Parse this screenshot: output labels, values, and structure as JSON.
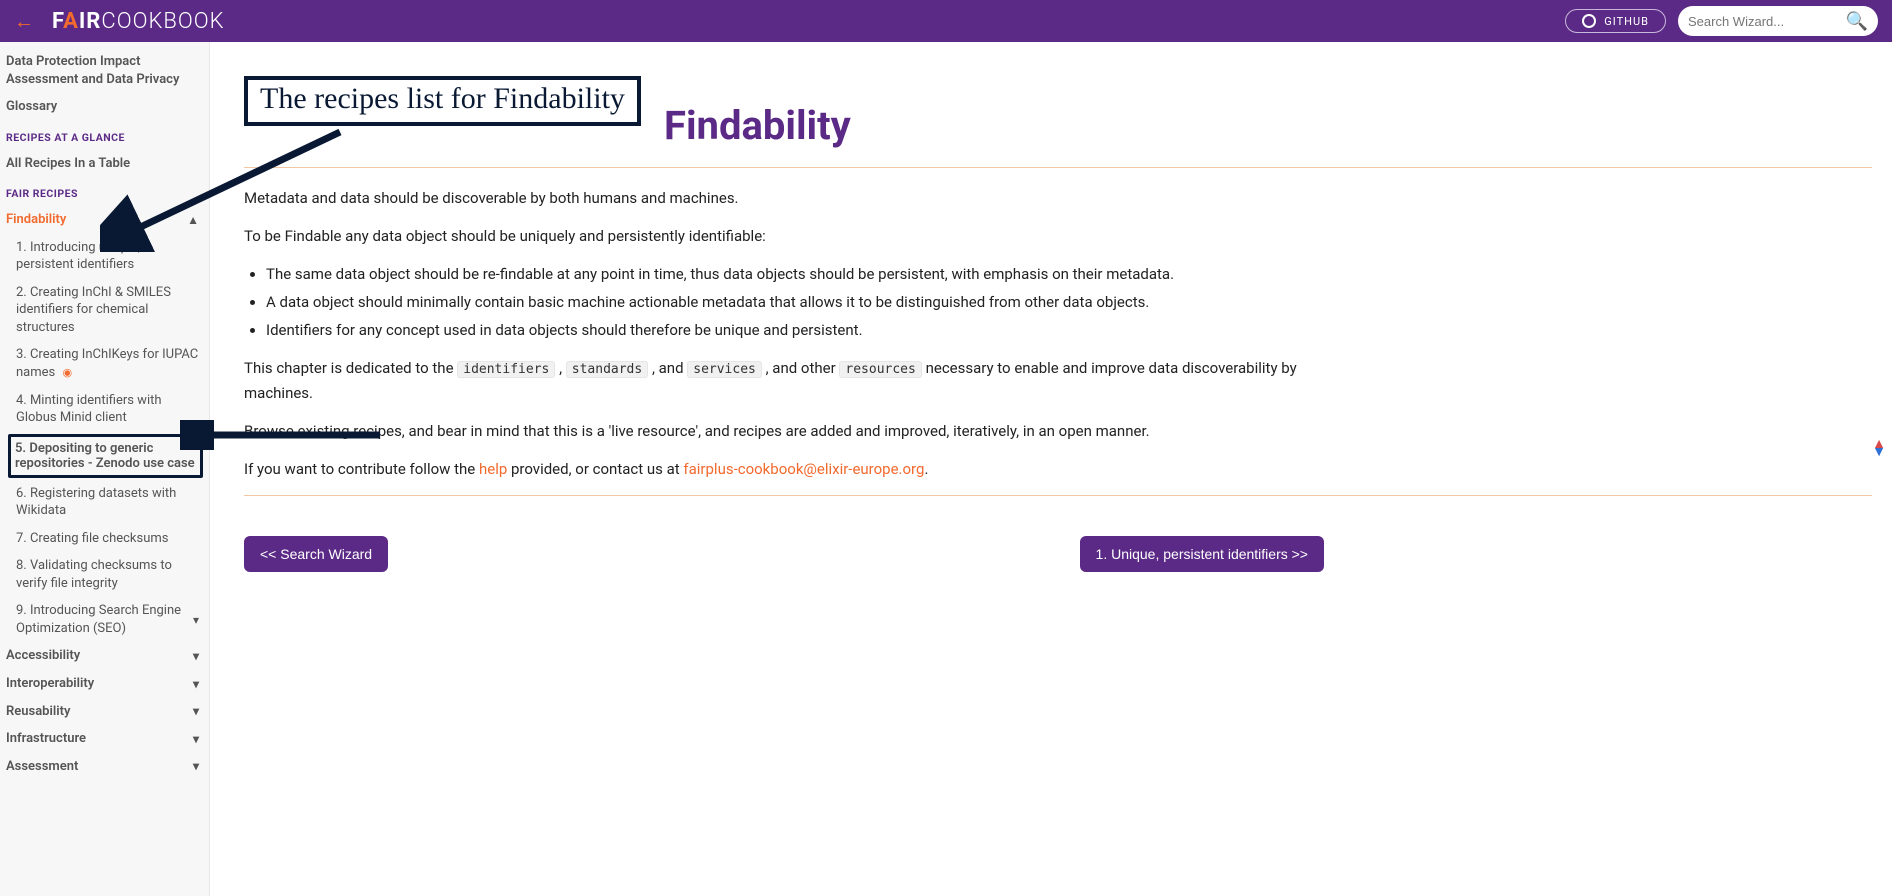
{
  "topbar": {
    "logo_f": "F",
    "logo_a": "A",
    "logo_ir": "IR",
    "logo_cookbook": "COOKBOOK",
    "github_label": "GITHUB",
    "search_placeholder": "Search Wizard..."
  },
  "sidebar": {
    "top_items": [
      "Data Protection Impact Assessment and Data Privacy",
      "Glossary"
    ],
    "section_glance_title": "RECIPES AT A GLANCE",
    "glance_item": "All Recipes In a Table",
    "section_recipes_title": "FAIR RECIPES",
    "findability": "Findability",
    "findability_items": [
      "1. Introducing unique, persistent identifiers",
      "2. Creating InChI & SMILES identifiers for chemical structures",
      "3. Creating InChIKeys for IUPAC names",
      "4. Minting identifiers with Globus Minid client",
      "5. Depositing to generic repositories - Zenodo use case",
      "6. Registering datasets with Wikidata",
      "7. Creating file checksums",
      "8. Validating checksums to verify file integrity",
      "9. Introducing Search Engine Optimization (SEO)"
    ],
    "groups": [
      "Accessibility",
      "Interoperability",
      "Reusability",
      "Infrastructure",
      "Assessment"
    ]
  },
  "annotation": {
    "label": "The recipes list for Findability"
  },
  "page": {
    "title": "Findability",
    "p1": "Metadata and data should be discoverable by both humans and machines.",
    "p2": "To be Findable any data object should be uniquely and persistently identifiable:",
    "bullets": [
      "The same data object should be re-findable at any point in time, thus data objects should be persistent, with emphasis on their metadata.",
      "A data object should minimally contain basic machine actionable metadata that allows it to be distinguished from other data objects.",
      "Identifiers for any concept used in data objects should therefore be unique and persistent."
    ],
    "p3_a": "This chapter is dedicated to the ",
    "chip1": "identifiers",
    "sep_comma_space": " , ",
    "chip2": "standards",
    "p3_b": " , and ",
    "chip3": "services",
    "p3_c": " , and other ",
    "chip4": "resources",
    "p3_d": " necessary to enable and improve data discoverability by machines.",
    "p4": "Browse existing recipes, and bear in mind that this is a 'live resource', and recipes are added and improved, iteratively, in an open manner.",
    "p5_a": "If you want to contribute follow the ",
    "help_link": "help",
    "p5_b": " provided, or contact us at ",
    "email_link": "fairplus-cookbook@elixir-europe.org",
    "p5_c": "."
  },
  "pager": {
    "prev": "<< Search Wizard",
    "next": "1. Unique, persistent identifiers >>"
  }
}
